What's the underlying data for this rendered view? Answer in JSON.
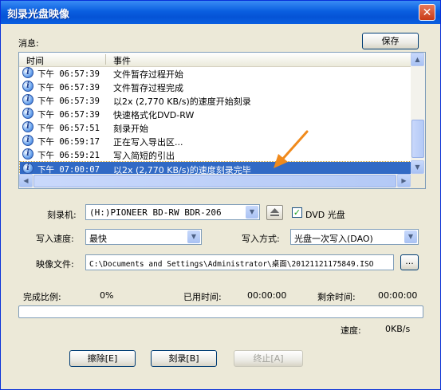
{
  "window": {
    "title": "刻录光盘映像",
    "close_glyph": "✕"
  },
  "messages": {
    "label": "消息:",
    "save_button": "保存",
    "columns": {
      "time": "时间",
      "event": "事件"
    },
    "rows": [
      {
        "time": "下午 06:57:39",
        "event": "文件暂存过程开始"
      },
      {
        "time": "下午 06:57:39",
        "event": "文件暂存过程完成"
      },
      {
        "time": "下午 06:57:39",
        "event": "以2x (2,770 KB/s)的速度开始刻录"
      },
      {
        "time": "下午 06:57:39",
        "event": "快速格式化DVD-RW"
      },
      {
        "time": "下午 06:57:51",
        "event": "刻录开始"
      },
      {
        "time": "下午 06:59:17",
        "event": "正在写入导出区..."
      },
      {
        "time": "下午 06:59:21",
        "event": "写入简短的引出"
      },
      {
        "time": "下午 07:00:07",
        "event": "以2x (2,770 KB/s)的速度刻录完毕",
        "selected": true
      }
    ],
    "row_icon": "info-icon"
  },
  "burner": {
    "label": "刻录机:",
    "value": "(H:)PIONEER  BD-RW   BDR-206",
    "dvd_checkbox_label": "DVD 光盘",
    "dvd_checked": true
  },
  "write_speed": {
    "label": "写入速度:",
    "value": "最快"
  },
  "write_mode": {
    "label": "写入方式:",
    "value": "光盘一次写入(DAO)"
  },
  "image_file": {
    "label": "映像文件:",
    "value": "C:\\Documents and Settings\\Administrator\\桌面\\20121121175849.ISO",
    "browse": "..."
  },
  "progress": {
    "complete_label": "完成比例:",
    "complete_value": "0%",
    "elapsed_label": "已用时间:",
    "elapsed_value": "00:00:00",
    "remaining_label": "剩余时间:",
    "remaining_value": "00:00:00",
    "fraction": 0,
    "speed_label": "速度:",
    "speed_value": "0KB/s"
  },
  "buttons": {
    "erase": "擦除[E]",
    "burn": "刻录[B]",
    "stop": "终止[A]"
  },
  "colors": {
    "title_bar": "#0a5fe0",
    "selection": "#316ac5",
    "annotation_arrow": "#f08a1c"
  }
}
